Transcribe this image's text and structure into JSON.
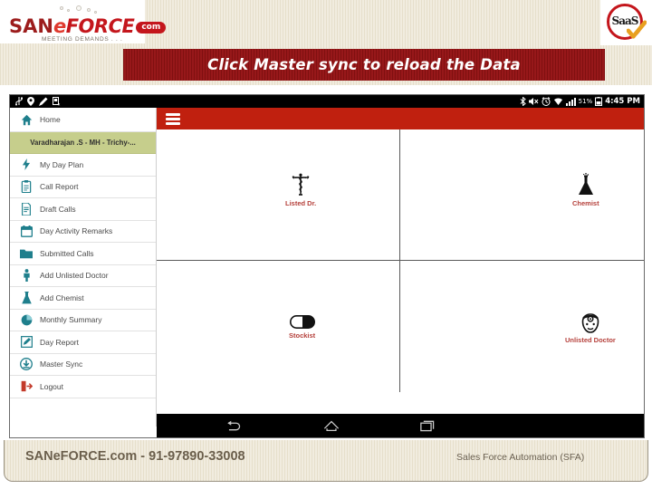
{
  "slide": {
    "brand": {
      "logo_san": "SAN",
      "logo_e": "e",
      "logo_force": "FORCE",
      "logo_com": "com",
      "logo_tagline": "MEETING DEMANDS . . .",
      "seal_text": "SaaS",
      "seal_icon": "check-icon",
      "brand_red": "#c4161c"
    },
    "banner": {
      "text": "Click Master sync to reload the Data",
      "bg_color": "#8c1212",
      "text_color": "#ffffff"
    },
    "footer": {
      "left_text": "SANeFORCE.com - 91-97890-33008",
      "right_text": "Sales Force Automation (SFA)"
    },
    "annotation": {
      "shape": "ellipse",
      "target": "Master Sync",
      "color": "#8c1230"
    }
  },
  "device": {
    "statusbar": {
      "left_icons": [
        "usb-icon",
        "location-icon",
        "pencil-icon",
        "sim-icon"
      ],
      "right_icons": [
        "bluetooth-icon",
        "mute-icon",
        "alarm-icon",
        "wifi-icon",
        "signal-icon",
        "battery-icon"
      ],
      "battery_percent": "51%",
      "clock": "4:45 PM"
    },
    "appbar": {
      "menu_icon": "hamburger-icon",
      "bg_color": "#c0200f"
    },
    "drawer": {
      "home_label": "Home",
      "home_icon": "house-icon",
      "user_label": "Varadharajan .S - MH - Trichy-...",
      "user_bg_color": "#c6ce8c",
      "items": [
        {
          "label": "My Day Plan",
          "icon": "bolt-icon"
        },
        {
          "label": "Call Report",
          "icon": "clipboard-icon"
        },
        {
          "label": "Draft Calls",
          "icon": "document-icon"
        },
        {
          "label": "Day Activity Remarks",
          "icon": "calendar-icon"
        },
        {
          "label": "Submitted Calls",
          "icon": "folder-icon"
        },
        {
          "label": "Add Unlisted Doctor",
          "icon": "person-icon"
        },
        {
          "label": "Add Chemist",
          "icon": "flask-icon"
        },
        {
          "label": "Monthly Summary",
          "icon": "pie-chart-icon"
        },
        {
          "label": "Day Report",
          "icon": "edit-square-icon"
        },
        {
          "label": "Master Sync",
          "icon": "download-circle-icon"
        },
        {
          "label": "Logout",
          "icon": "logout-icon"
        }
      ]
    },
    "grid": {
      "label_color": "#b5403b",
      "tiles": [
        {
          "label": "Listed Dr.",
          "icon": "caduceus-icon"
        },
        {
          "label": "Chemist",
          "icon": "flask-icon"
        },
        {
          "label": "Stockist",
          "icon": "capsule-icon"
        },
        {
          "label": "Unlisted Doctor",
          "icon": "doctor-face-icon"
        }
      ]
    },
    "navbar": {
      "back_icon": "back-arrow-icon",
      "home_icon": "home-outline-icon",
      "recent_icon": "recent-apps-icon"
    }
  }
}
